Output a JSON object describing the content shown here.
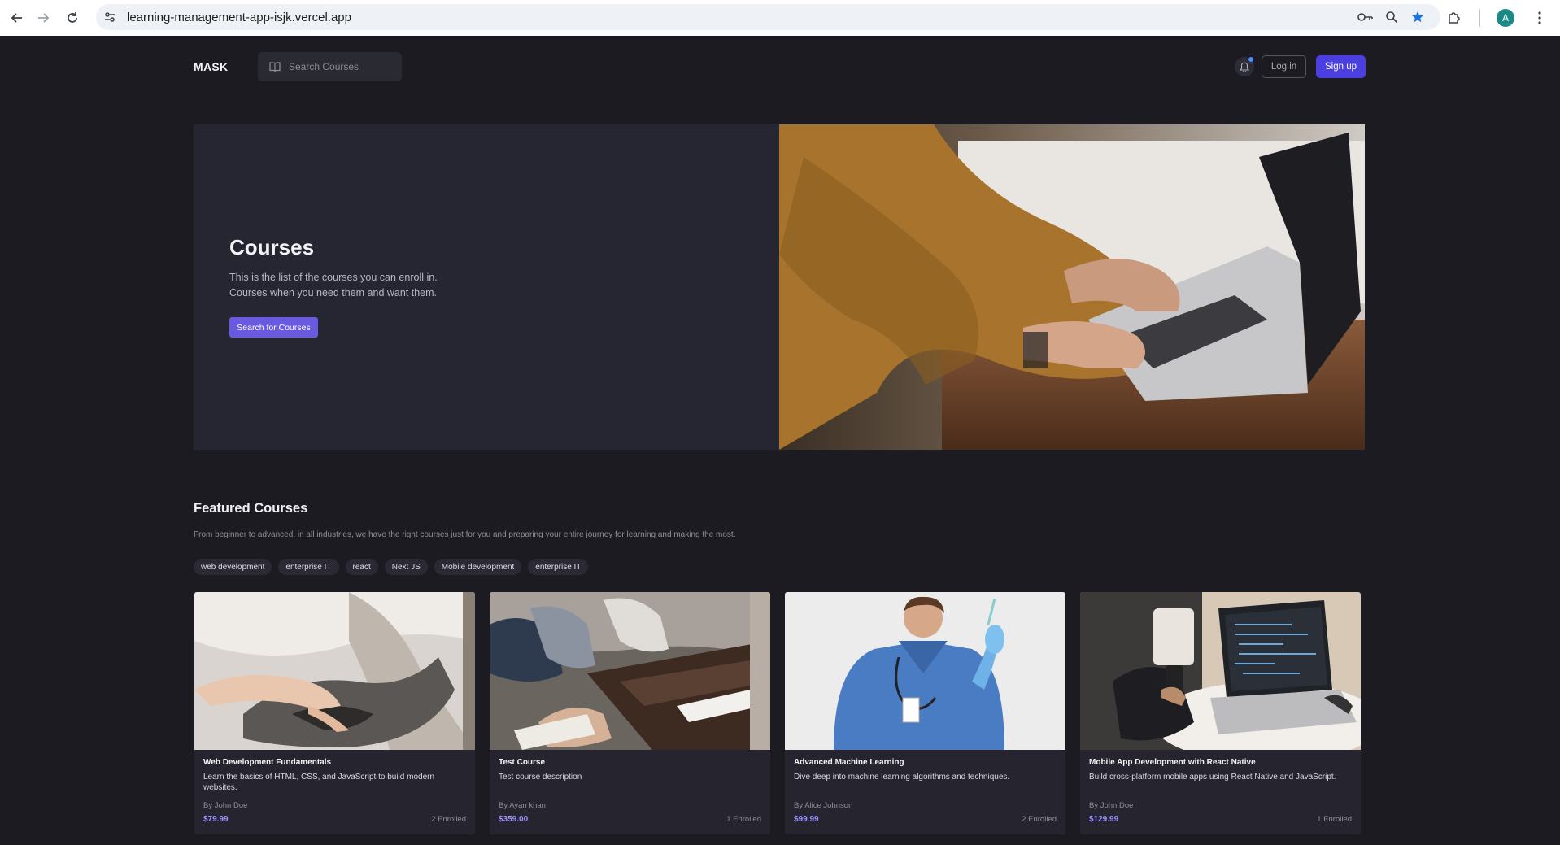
{
  "browser": {
    "url": "learning-management-app-isjk.vercel.app",
    "profile_initial": "A",
    "icons": [
      "back-icon",
      "forward-icon",
      "reload-icon",
      "site-settings-icon",
      "password-key-icon",
      "zoom-icon",
      "bookmark-star-icon",
      "extensions-icon",
      "profile-avatar",
      "menu-kebab-icon"
    ]
  },
  "navbar": {
    "logo": "MASK",
    "search_placeholder": "Search Courses",
    "login_label": "Log in",
    "signup_label": "Sign up"
  },
  "hero": {
    "title": "Courses",
    "description": "This is the list of the courses you can enroll in. Courses when you need them and want them.",
    "button_label": "Search for Courses"
  },
  "featured": {
    "title": "Featured Courses",
    "description": "From beginner to advanced, in all industries, we have the right courses just for you and preparing your entire journey for learning and making the most.",
    "tags": [
      "web development",
      "enterprise IT",
      "react",
      "Next JS",
      "Mobile development",
      "enterprise IT"
    ]
  },
  "courses": [
    {
      "title": "Web Development Fundamentals",
      "description": "Learn the basics of HTML, CSS, and JavaScript to build modern websites.",
      "author": "By John Doe",
      "price": "$79.99",
      "enrolled": "2 Enrolled"
    },
    {
      "title": "Test Course",
      "description": "Test course description",
      "author": "By Ayan khan",
      "price": "$359.00",
      "enrolled": "1 Enrolled"
    },
    {
      "title": "Advanced Machine Learning",
      "description": "Dive deep into machine learning algorithms and techniques.",
      "author": "By Alice Johnson",
      "price": "$99.99",
      "enrolled": "2 Enrolled"
    },
    {
      "title": "Mobile App Development with React Native",
      "description": "Build cross-platform mobile apps using React Native and JavaScript.",
      "author": "By John Doe",
      "price": "$129.99",
      "enrolled": "1 Enrolled"
    }
  ],
  "colors": {
    "page_bg": "#1c1b22",
    "hero_bg": "#262532",
    "accent": "#4b3fe0",
    "hero_button": "#6a5ae0",
    "price": "#9d94ff"
  }
}
